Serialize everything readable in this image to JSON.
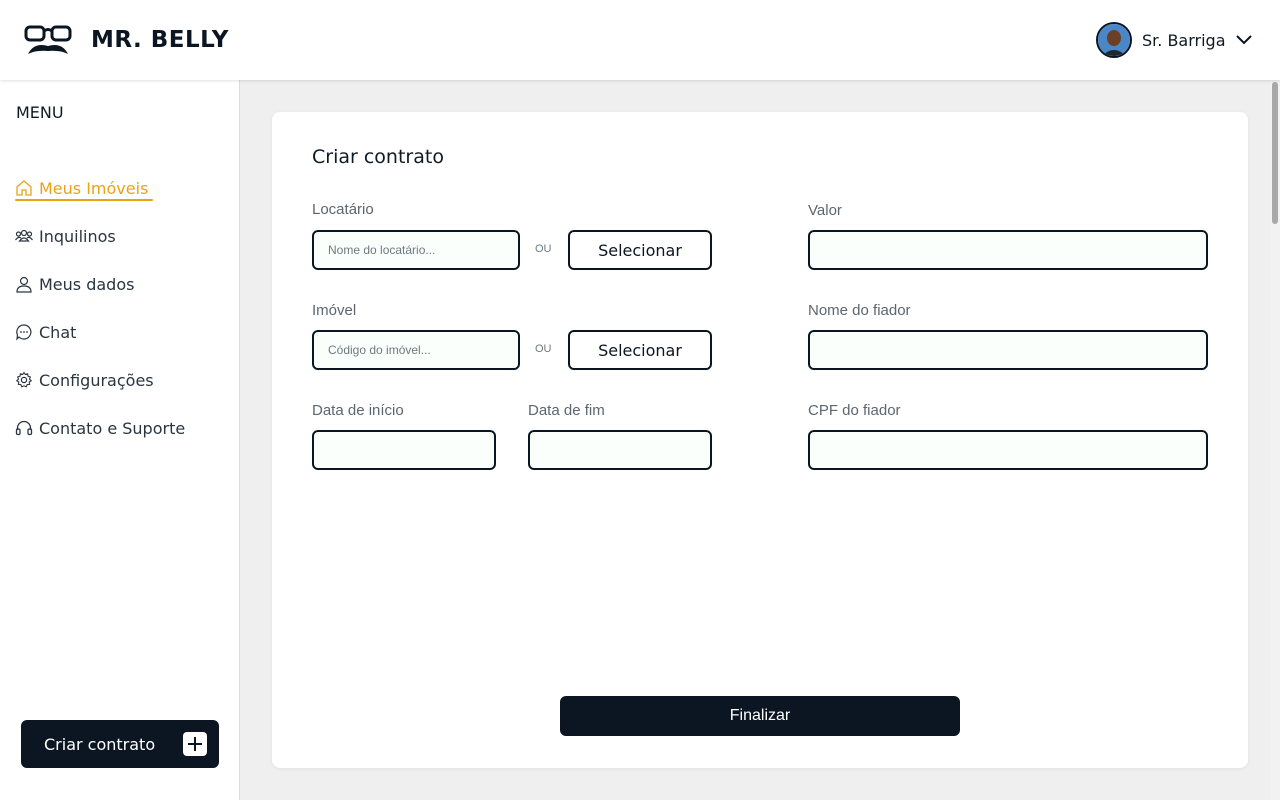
{
  "header": {
    "brand": "MR. BELLY",
    "user_name": "Sr. Barriga",
    "logo_icon": "glasses-mustache-logo",
    "user_menu_icon": "chevron-down-icon"
  },
  "sidebar": {
    "menu_title": "MENU",
    "items": [
      {
        "label": "Meus Imóveis",
        "icon": "home-icon",
        "active": true
      },
      {
        "label": "Inquilinos",
        "icon": "users-icon",
        "active": false
      },
      {
        "label": "Meus dados",
        "icon": "user-icon",
        "active": false
      },
      {
        "label": "Chat",
        "icon": "chat-icon",
        "active": false
      },
      {
        "label": "Configurações",
        "icon": "gear-icon",
        "active": false
      },
      {
        "label": "Contato e Suporte",
        "icon": "headset-icon",
        "active": false
      }
    ],
    "create_button": "Criar contrato"
  },
  "form": {
    "title": "Criar contrato",
    "locatario_label": "Locatário",
    "locatario_placeholder": "Nome do locatário...",
    "imovel_label": "Imóvel",
    "imovel_placeholder": "Código do imóvel...",
    "or_text": "OU",
    "select_button": "Selecionar",
    "start_date_label": "Data de início",
    "end_date_label": "Data de fim",
    "valor_label": "Valor",
    "fiador_name_label": "Nome do fiador",
    "fiador_cpf_label": "CPF do fiador",
    "submit_button": "Finalizar"
  },
  "colors": {
    "primary": "#0b1622",
    "accent": "#e8a317",
    "background": "#efefef"
  }
}
